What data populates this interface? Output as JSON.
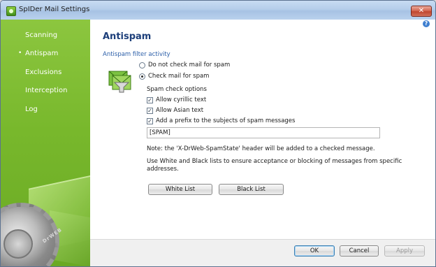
{
  "window": {
    "title": "SpIDer Mail Settings",
    "close_glyph": "✕"
  },
  "sidebar": {
    "items": [
      {
        "label": "Scanning",
        "selected": false
      },
      {
        "label": "Antispam",
        "selected": true,
        "bullet": "•"
      },
      {
        "label": "Exclusions",
        "selected": false
      },
      {
        "label": "Interception",
        "selected": false
      },
      {
        "label": "Log",
        "selected": false
      }
    ],
    "art_icon": "gear-envelope-art",
    "art_text": "DrWEB"
  },
  "content": {
    "help_glyph": "?",
    "title": "Antispam",
    "section_label": "Antispam filter activity",
    "illustration_icon": "spam-filter-funnel-icon",
    "radio_no_check": {
      "label": "Do not check mail for spam",
      "selected": false
    },
    "radio_check": {
      "label": "Check mail for spam",
      "selected": true
    },
    "options_label": "Spam check options",
    "check_cyrillic": {
      "label": "Allow cyrillic text",
      "checked": true
    },
    "check_asian": {
      "label": "Allow Asian text",
      "checked": true
    },
    "check_prefix": {
      "label": "Add a prefix to the subjects of spam messages",
      "checked": true
    },
    "prefix_value": "[SPAM]",
    "note": "Note: the 'X-DrWeb-SpamState' header will be added to a checked message.",
    "lists_hint_line1": "Use White and Black lists to ensure acceptance or blocking of messages from specific",
    "lists_hint_line2": "addresses.",
    "white_list_label": "White List",
    "black_list_label": "Black List",
    "check_glyph": "✓"
  },
  "footer": {
    "ok_label": "OK",
    "cancel_label": "Cancel",
    "apply_label": "Apply"
  },
  "colors": {
    "sidebar_green": "#78b82c",
    "title_blue": "#1d3f7a",
    "link_blue": "#2b5ea8"
  }
}
